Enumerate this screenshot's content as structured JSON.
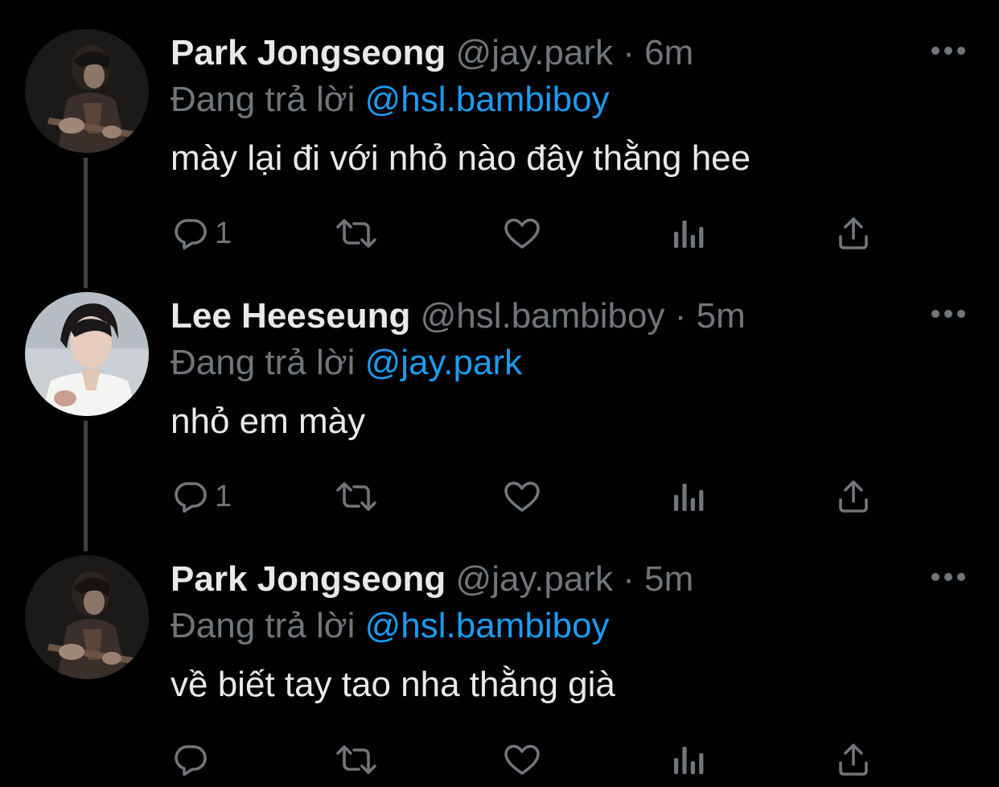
{
  "reply_prefix": "Đang trả lời",
  "colors": {
    "background": "#000000",
    "text": "#e7e9ea",
    "secondary": "#71767b",
    "link": "#1d9bf0",
    "thread_line": "#3d4248"
  },
  "tweets": [
    {
      "display_name": "Park Jongseong",
      "handle": "@jay.park",
      "time": "· 6m",
      "replying_to": "@hsl.bambiboy",
      "text": "mày lại đi với nhỏ nào đây thằng hee",
      "reply_count": "1",
      "avatar_icon": "avatar-photo-guitar"
    },
    {
      "display_name": "Lee Heeseung",
      "handle": "@hsl.bambiboy",
      "time": "· 5m",
      "replying_to": "@jay.park",
      "text": "nhỏ em mày",
      "reply_count": "1",
      "avatar_icon": "avatar-photo-portrait"
    },
    {
      "display_name": "Park Jongseong",
      "handle": "@jay.park",
      "time": "· 5m",
      "replying_to": "@hsl.bambiboy",
      "text": "về biết tay tao nha thằng già",
      "reply_count": "",
      "avatar_icon": "avatar-photo-guitar"
    }
  ]
}
